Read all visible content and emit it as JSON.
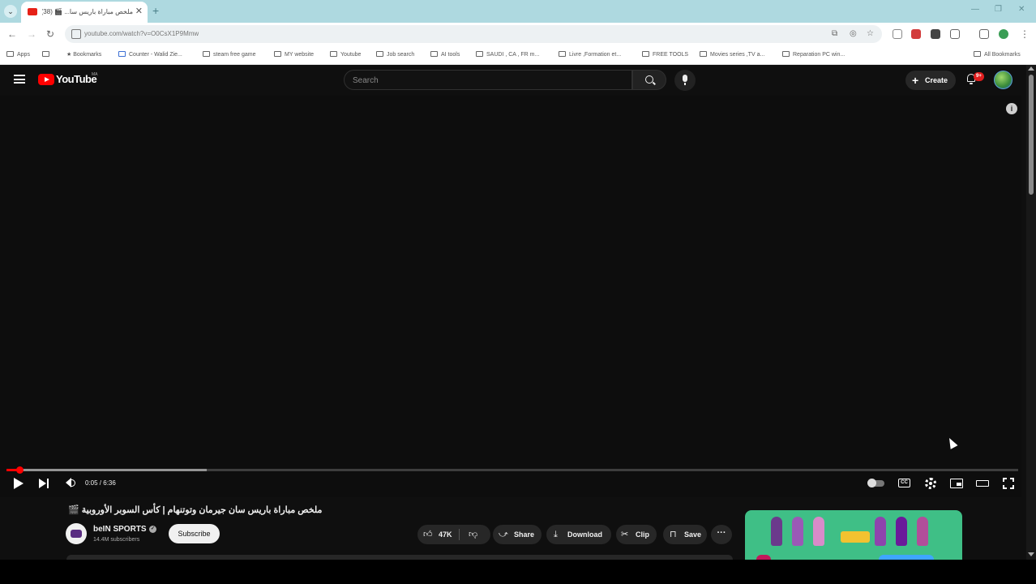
{
  "browser": {
    "tab": {
      "title": "ملخص مباراة باريس سا... 🎬 (38)",
      "close_glyph": "✕"
    },
    "new_tab_glyph": "+",
    "url": "youtube.com/watch?v=O0CsX1P9Mmw",
    "bookmarks": [
      {
        "label": "Apps"
      },
      {
        "label": "Bookmarks"
      },
      {
        "label": "Counter - Walid Zie..."
      },
      {
        "label": "steam free game"
      },
      {
        "label": "MY website"
      },
      {
        "label": "Youtube"
      },
      {
        "label": "Job search"
      },
      {
        "label": "AI tools"
      },
      {
        "label": "SAUDI , CA , FR m..."
      },
      {
        "label": "Livre ,Formation et..."
      },
      {
        "label": "FREE TOOLS"
      },
      {
        "label": "Movies series ,TV a..."
      },
      {
        "label": "Reparation PC win..."
      }
    ],
    "all_bookmarks": "All Bookmarks"
  },
  "youtube": {
    "logo_text": "YouTube",
    "country_code": "MA",
    "search_placeholder": "Search",
    "create_label": "Create",
    "notification_badge": "9+"
  },
  "player": {
    "current_time": "0:05",
    "duration": "6:36",
    "time_display": "0:05 / 6:36",
    "played_fraction": 0.0126,
    "buffered_fraction": 0.198,
    "info_glyph": "i",
    "cc_text": "CC"
  },
  "video": {
    "title": "ملخص مباراة باريس سان جيرمان وتوتنهام | كأس السوبر الأوروبية 🎬",
    "channel_name": "beIN SPORTS",
    "subscribers": "14.4M subscribers",
    "subscribe_label": "Subscribe",
    "likes": "47K",
    "share_label": "Share",
    "download_label": "Download",
    "clip_label": "Clip",
    "save_label": "Save",
    "more_glyph": "···",
    "verified_glyph": "✓"
  },
  "colors": {
    "accent_red": "#ff0000",
    "page_bg": "#0f0f0f",
    "tab_strip": "#aed9e0"
  }
}
